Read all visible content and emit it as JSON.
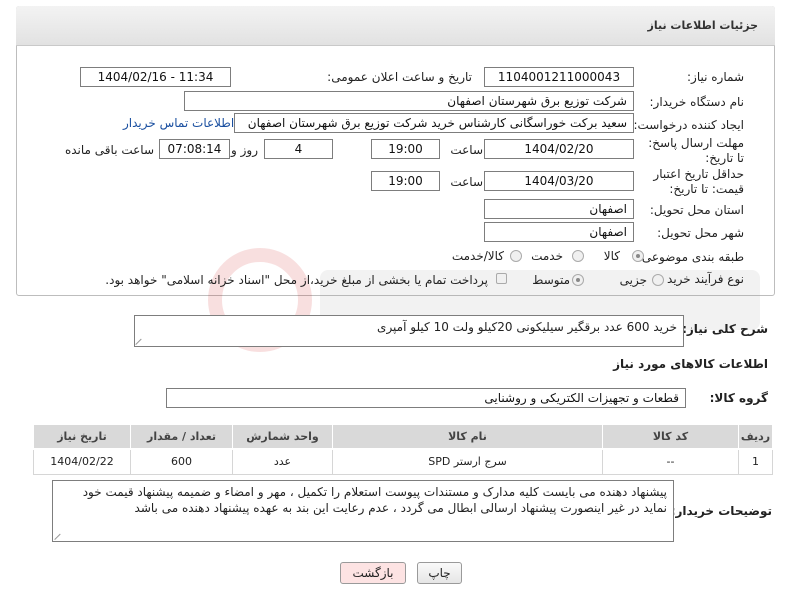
{
  "panel": {
    "title": "جزئیات اطلاعات نیاز"
  },
  "need_number": {
    "label": "شماره نیاز:",
    "value": "1104001211000043"
  },
  "announce_datetime": {
    "label": "تاریخ و ساعت اعلان عمومی:",
    "value": "1404/02/16 - 11:34"
  },
  "buyer_org": {
    "label": "نام دستگاه خریدار:",
    "value": "شرکت توزیع برق شهرستان اصفهان"
  },
  "requester": {
    "label": "ایجاد کننده درخواست:",
    "value": "سعید برکت خوراسگانی کارشناس خرید شرکت توزیع برق شهرستان اصفهان",
    "contact_link": "اطلاعات تماس خریدار"
  },
  "response_deadline": {
    "label": "مهلت ارسال پاسخ: تا تاریخ:",
    "date": "1404/02/20",
    "time_label": "ساعت",
    "time": "19:00",
    "days": "4",
    "days_label": "روز و",
    "remaining": "07:08:14",
    "remaining_label": "ساعت باقی مانده"
  },
  "price_validity": {
    "label": "حداقل تاریخ اعتبار قیمت: تا تاریخ:",
    "date": "1404/03/20",
    "time_label": "ساعت",
    "time": "19:00"
  },
  "delivery_province": {
    "label": "استان محل تحویل:",
    "value": "اصفهان"
  },
  "delivery_city": {
    "label": "شهر محل تحویل:",
    "value": "اصفهان"
  },
  "category": {
    "label": "طبقه بندی موضوعی:",
    "options": [
      "کالا",
      "خدمت",
      "کالا/خدمت"
    ],
    "selected": "کالا"
  },
  "process_type": {
    "label": "نوع فرآیند خرید :",
    "options": [
      "جزیی",
      "متوسط"
    ],
    "selected": "متوسط",
    "payment_note": "پرداخت تمام یا بخشی از مبلغ خرید،از محل \"اسناد خزانه اسلامی\" خواهد بود."
  },
  "description": {
    "label": "شرح کلی نیاز:",
    "value": "خرید 600 عدد برقگیر سیلیکونی 20کیلو ولت 10 کیلو آمپری"
  },
  "goods_info": {
    "title": "اطلاعات کالاهای مورد نیاز"
  },
  "goods_group": {
    "label": "گروه کالا:",
    "value": "قطعات و تجهیزات الکتریکی و روشنایی"
  },
  "items_table": {
    "headers": [
      "ردیف",
      "کد کالا",
      "نام کالا",
      "واحد شمارش",
      "تعداد / مقدار",
      "تاریخ نیاز"
    ],
    "rows": [
      {
        "row": "1",
        "code": "--",
        "name": "سرج ارستر SPD",
        "unit": "عدد",
        "qty": "600",
        "date": "1404/02/22"
      }
    ]
  },
  "buyer_notes": {
    "label": "توضیحات خریدار:",
    "value": "پیشنهاد دهنده می بایست کلیه مدارک و مستندات پیوست استعلام را تکمیل ، مهر و امضاء و ضمیمه پیشنهاد قیمت خود نماید در غیر اینصورت پیشنهاد ارسالی ابطال می گردد ، عدم رعایت این بند به عهده پیشنهاد دهنده می باشد"
  },
  "buttons": {
    "print": "چاپ",
    "back": "بازگشت"
  },
  "colors": {
    "back_button_bg": "#fde3e3",
    "link": "#1a4fa0"
  }
}
